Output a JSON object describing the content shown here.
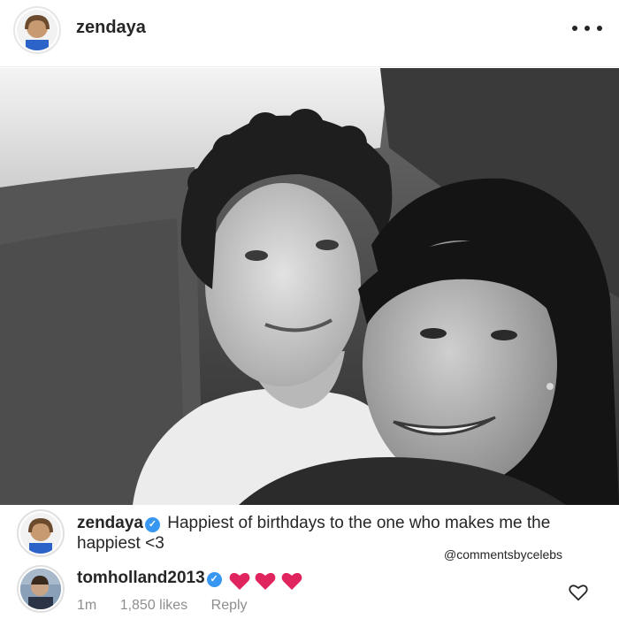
{
  "header": {
    "username": "zendaya",
    "avatar_icon": "profile-avatar",
    "more_icon": "more-options-icon"
  },
  "photo": {
    "style": "black-and-white"
  },
  "caption": {
    "username": "zendaya",
    "text": "Happiest of birthdays to the one who makes me the happiest <3",
    "verified": true
  },
  "watermark": "@commentsbycelebs",
  "reply_comment": {
    "username": "tomholland2013",
    "verified": true,
    "hearts": 3,
    "heart_color": "#e0245e",
    "time": "1m",
    "likes": "1,850 likes",
    "reply_label": "Reply"
  },
  "colors": {
    "verified_blue": "#3897f0",
    "meta_gray": "#8e8e8e",
    "text": "#262626"
  }
}
